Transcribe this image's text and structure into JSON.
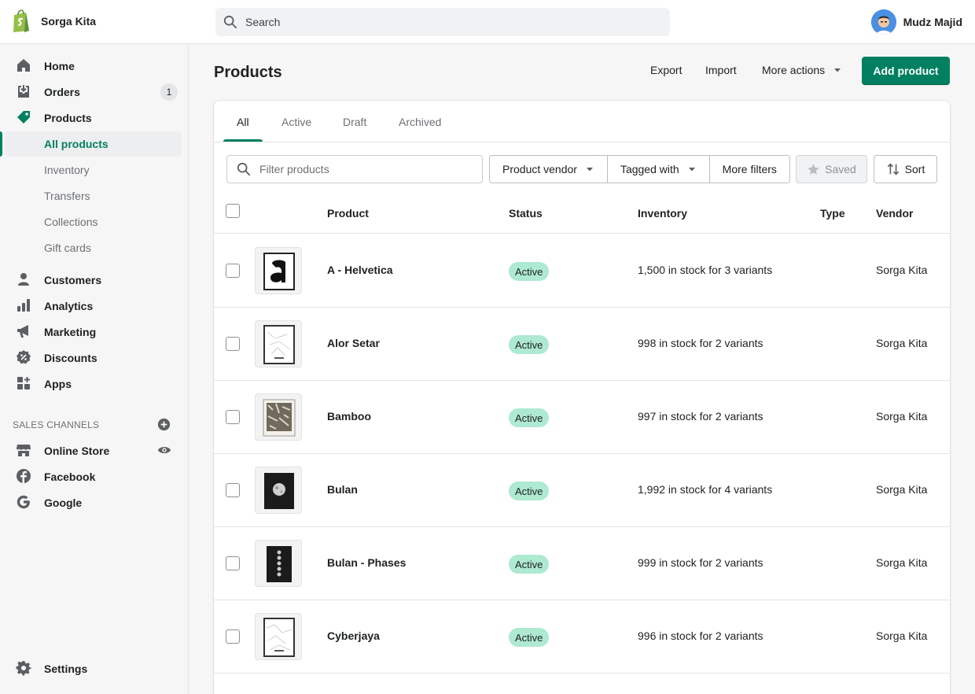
{
  "store": {
    "name": "Sorga Kita"
  },
  "search": {
    "placeholder": "Search"
  },
  "user": {
    "name": "Mudz Majid"
  },
  "sidebar": {
    "main": [
      {
        "label": "Home",
        "icon": "home-icon"
      },
      {
        "label": "Orders",
        "icon": "orders-icon",
        "badge": "1"
      },
      {
        "label": "Products",
        "icon": "tag-icon"
      }
    ],
    "products_sub": [
      {
        "label": "All products",
        "active": true
      },
      {
        "label": "Inventory"
      },
      {
        "label": "Transfers"
      },
      {
        "label": "Collections"
      },
      {
        "label": "Gift cards"
      }
    ],
    "rest": [
      {
        "label": "Customers",
        "icon": "person-icon"
      },
      {
        "label": "Analytics",
        "icon": "bar-chart-icon"
      },
      {
        "label": "Marketing",
        "icon": "megaphone-icon"
      },
      {
        "label": "Discounts",
        "icon": "discount-icon"
      },
      {
        "label": "Apps",
        "icon": "apps-icon"
      }
    ],
    "sales_channels_title": "SALES CHANNELS",
    "channels": [
      {
        "label": "Online Store",
        "icon": "store-icon"
      },
      {
        "label": "Facebook",
        "icon": "facebook-icon"
      },
      {
        "label": "Google",
        "icon": "google-icon"
      }
    ],
    "settings": "Settings"
  },
  "page": {
    "title": "Products",
    "export": "Export",
    "import": "Import",
    "more_actions": "More actions",
    "add_product": "Add product"
  },
  "tabs": [
    "All",
    "Active",
    "Draft",
    "Archived"
  ],
  "filters": {
    "placeholder": "Filter products",
    "product_vendor": "Product vendor",
    "tagged_with": "Tagged with",
    "more_filters": "More filters",
    "saved": "Saved",
    "sort": "Sort"
  },
  "table": {
    "headers": {
      "product": "Product",
      "status": "Status",
      "inventory": "Inventory",
      "type": "Type",
      "vendor": "Vendor"
    },
    "rows": [
      {
        "name": "A - Helvetica",
        "status": "Active",
        "inventory": "1,500 in stock for 3 variants",
        "type": "",
        "vendor": "Sorga Kita",
        "thumb": "helvetica"
      },
      {
        "name": "Alor Setar",
        "status": "Active",
        "inventory": "998 in stock for 2 variants",
        "type": "",
        "vendor": "Sorga Kita",
        "thumb": "map"
      },
      {
        "name": "Bamboo",
        "status": "Active",
        "inventory": "997 in stock for 2 variants",
        "type": "",
        "vendor": "Sorga Kita",
        "thumb": "bamboo"
      },
      {
        "name": "Bulan",
        "status": "Active",
        "inventory": "1,992 in stock for 4 variants",
        "type": "",
        "vendor": "Sorga Kita",
        "thumb": "moon"
      },
      {
        "name": "Bulan - Phases",
        "status": "Active",
        "inventory": "999 in stock for 2 variants",
        "type": "",
        "vendor": "Sorga Kita",
        "thumb": "phases"
      },
      {
        "name": "Cyberjaya",
        "status": "Active",
        "inventory": "996 in stock for 2 variants",
        "type": "",
        "vendor": "Sorga Kita",
        "thumb": "map"
      }
    ]
  },
  "colors": {
    "accent": "#008060",
    "badge_active": "#aee9d1"
  }
}
